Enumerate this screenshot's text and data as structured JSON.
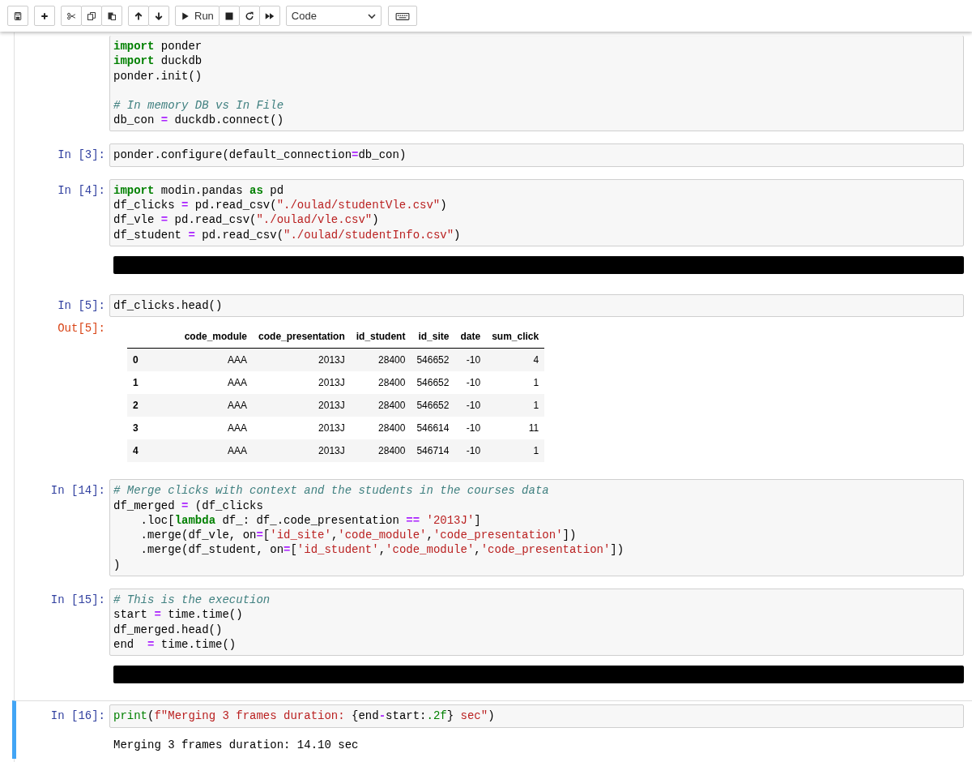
{
  "toolbar": {
    "run_label": "Run",
    "cell_type": "Code"
  },
  "cells": [
    {
      "selected": false,
      "source": "import ponder\nimport duckdb\nponder.init()\n\n# In memory DB vs In File\ndb_con = duckdb.connect()"
    },
    {
      "prompt": "In [3]:",
      "selected": false,
      "source": "ponder.configure(default_connection=db_con)"
    },
    {
      "prompt": "In [4]:",
      "selected": false,
      "source": "import modin.pandas as pd\ndf_clicks = pd.read_csv(\"./oulad/studentVle.csv\")\ndf_vle = pd.read_csv(\"./oulad/vle.csv\")\ndf_student = pd.read_csv(\"./oulad/studentInfo.csv\")",
      "output": {
        "kind": "redacted"
      }
    },
    {
      "prompt": "In [5]:",
      "selected": false,
      "source": "df_clicks.head()",
      "output": {
        "kind": "table",
        "prompt": "Out[5]:",
        "columns": [
          "",
          "code_module",
          "code_presentation",
          "id_student",
          "id_site",
          "date",
          "sum_click"
        ],
        "rows": [
          [
            "0",
            "AAA",
            "2013J",
            "28400",
            "546652",
            "-10",
            "4"
          ],
          [
            "1",
            "AAA",
            "2013J",
            "28400",
            "546652",
            "-10",
            "1"
          ],
          [
            "2",
            "AAA",
            "2013J",
            "28400",
            "546652",
            "-10",
            "1"
          ],
          [
            "3",
            "AAA",
            "2013J",
            "28400",
            "546614",
            "-10",
            "11"
          ],
          [
            "4",
            "AAA",
            "2013J",
            "28400",
            "546714",
            "-10",
            "1"
          ]
        ]
      }
    },
    {
      "prompt": "In [14]:",
      "selected": false,
      "source": "# Merge clicks with context and the students in the courses data\ndf_merged = (df_clicks\n    .loc[lambda df_: df_.code_presentation == '2013J']\n    .merge(df_vle, on=['id_site','code_module','code_presentation'])\n    .merge(df_student, on=['id_student','code_module','code_presentation'])\n)"
    },
    {
      "prompt": "In [15]:",
      "selected": false,
      "source": "# This is the execution\nstart = time.time()\ndf_merged.head()\nend  = time.time()",
      "output": {
        "kind": "redacted"
      }
    },
    {
      "prompt": "In [16]:",
      "selected": true,
      "source": "print(f\"Merging 3 frames duration: {end-start:.2f} sec\")",
      "output": {
        "kind": "stream",
        "text": "Merging 3 frames duration: 14.10 sec"
      }
    }
  ]
}
